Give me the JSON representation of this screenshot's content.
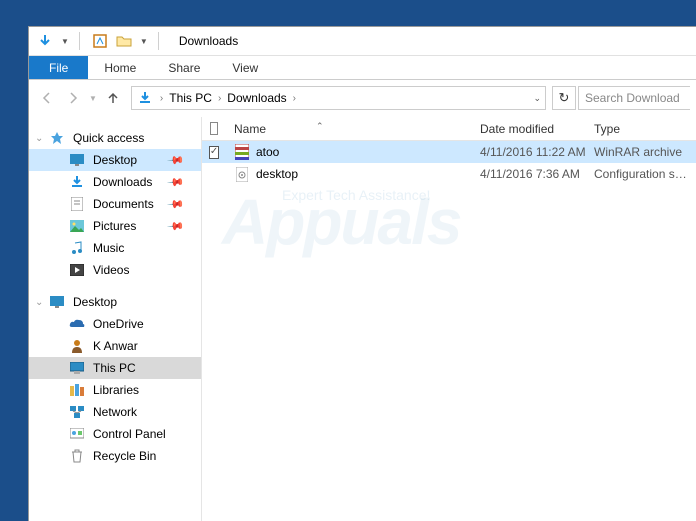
{
  "titlebar": {
    "title": "Downloads"
  },
  "ribbon": {
    "tabs": [
      "File",
      "Home",
      "Share",
      "View"
    ]
  },
  "address": {
    "crumbs": [
      "This PC",
      "Downloads"
    ]
  },
  "search": {
    "placeholder": "Search Download"
  },
  "sidebar": {
    "quick_access": {
      "label": "Quick access",
      "items": [
        {
          "label": "Desktop",
          "pinned": true
        },
        {
          "label": "Downloads",
          "pinned": true
        },
        {
          "label": "Documents",
          "pinned": true
        },
        {
          "label": "Pictures",
          "pinned": true
        },
        {
          "label": "Music",
          "pinned": false
        },
        {
          "label": "Videos",
          "pinned": false
        }
      ]
    },
    "desktop": {
      "label": "Desktop",
      "items": [
        {
          "label": "OneDrive"
        },
        {
          "label": "K Anwar"
        },
        {
          "label": "This PC"
        },
        {
          "label": "Libraries"
        },
        {
          "label": "Network"
        },
        {
          "label": "Control Panel"
        },
        {
          "label": "Recycle Bin"
        }
      ]
    }
  },
  "columns": {
    "name": "Name",
    "date": "Date modified",
    "type": "Type"
  },
  "files": [
    {
      "name": "atoo",
      "date": "4/11/2016 11:22 AM",
      "type": "WinRAR archive",
      "icon": "rar",
      "selected": true
    },
    {
      "name": "desktop",
      "date": "4/11/2016 7:36 AM",
      "type": "Configuration sett...",
      "icon": "ini",
      "selected": false
    }
  ]
}
